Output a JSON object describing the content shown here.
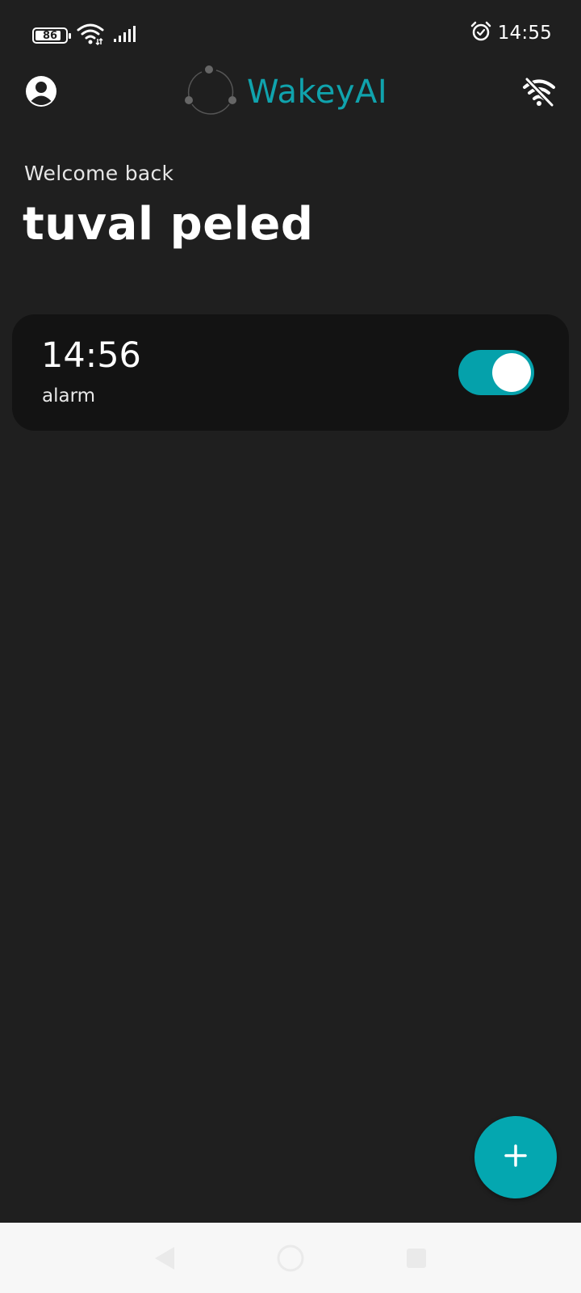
{
  "status_bar": {
    "battery_level": "86",
    "battery_fraction": 0.86,
    "time": "14:55",
    "icons": [
      "battery-icon",
      "wifi-icon",
      "signal-icon",
      "alarm-clock-icon"
    ]
  },
  "app_bar": {
    "app_name": "WakeyAI",
    "left_icon": "account-circle-icon",
    "right_icon": "wifi-off-icon",
    "logo_icon": "cycle-logo-icon"
  },
  "welcome": {
    "subtitle": "Welcome back",
    "name": "tuval peled"
  },
  "alarms": [
    {
      "time": "14:56",
      "label": "alarm",
      "enabled": true
    }
  ],
  "fab": {
    "icon": "plus-icon"
  },
  "navigation": {
    "buttons": [
      "back-icon",
      "home-icon",
      "recents-icon"
    ]
  },
  "colors": {
    "background": "#1f1f1f",
    "card": "#131313",
    "accent": "#04a7b0",
    "brand_text": "#10a3ad",
    "nav_bar": "#f7f7f7"
  }
}
